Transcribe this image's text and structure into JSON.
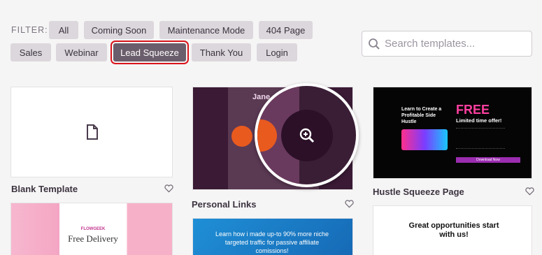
{
  "filter": {
    "label": "FILTER:",
    "row1": [
      "All",
      "Coming Soon",
      "Maintenance Mode",
      "404 Page"
    ],
    "row2": [
      "Sales",
      "Webinar",
      "Lead Squeeze",
      "Thank You",
      "Login"
    ],
    "active": "Lead Squeeze"
  },
  "search": {
    "placeholder": "Search templates..."
  },
  "templates": {
    "blank": {
      "title": "Blank Template"
    },
    "personal": {
      "title": "Personal Links",
      "name_text": "Jane"
    },
    "hustle": {
      "title": "Hustle Squeeze Page",
      "headline": "Learn to Create a Profitable Side Hustle",
      "free": "FREE",
      "subhead": "Limited time offer!",
      "button": "Download Now"
    },
    "free_delivery": {
      "brand": "FLOWGEEK",
      "headline": "Free Delivery"
    },
    "affiliate": {
      "text": "Learn how i made up-to 90% more niche targeted traffic for passive affiliate comissions!"
    },
    "opportunities": {
      "text": "Great opportunities start with us!"
    }
  },
  "colors": {
    "active_pill": "#6b5e6c",
    "highlight": "#d9141c",
    "hustle_free": "#ff3fa0"
  }
}
